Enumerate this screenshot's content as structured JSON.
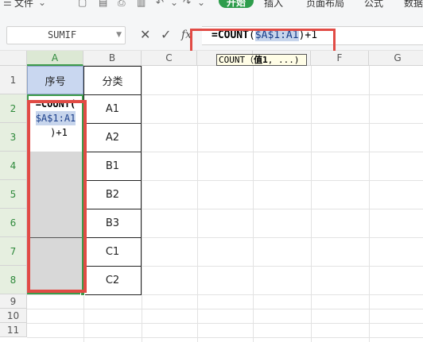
{
  "menubar": {
    "file_label": "文件",
    "start_tab": "开始",
    "insert_tab": "插入",
    "layout_tab": "页面布局",
    "formula_tab": "公式",
    "data_tab": "数据"
  },
  "formula_bar": {
    "name_box_value": "SUMIF",
    "fx_label": "fx",
    "formula_fn": "=COUNT",
    "formula_open": "(",
    "formula_ref": "$A$1:A1",
    "formula_close": ")",
    "formula_tail": "+1"
  },
  "tooltip": {
    "fn": "COUNT",
    "open": "（",
    "arg": "值1",
    "rest": ", ...)"
  },
  "columns": [
    "A",
    "B",
    "C",
    "D",
    "E",
    "F",
    "G"
  ],
  "rows": [
    "1",
    "2",
    "3",
    "4",
    "5",
    "6",
    "7",
    "8",
    "9",
    "10",
    "11"
  ],
  "cells": {
    "a1": "序号",
    "b1": "分类",
    "a2_line1": "=COUNT(",
    "a2_line2": "$A$1:A1",
    "a2_line3": ")+1",
    "b_values": [
      "A1",
      "A2",
      "B1",
      "B2",
      "B3",
      "C1",
      "C2"
    ]
  },
  "colors": {
    "accent_green": "#2e9d4c",
    "highlight_red": "#e14b45",
    "header_blue": "#c9d7f0"
  }
}
